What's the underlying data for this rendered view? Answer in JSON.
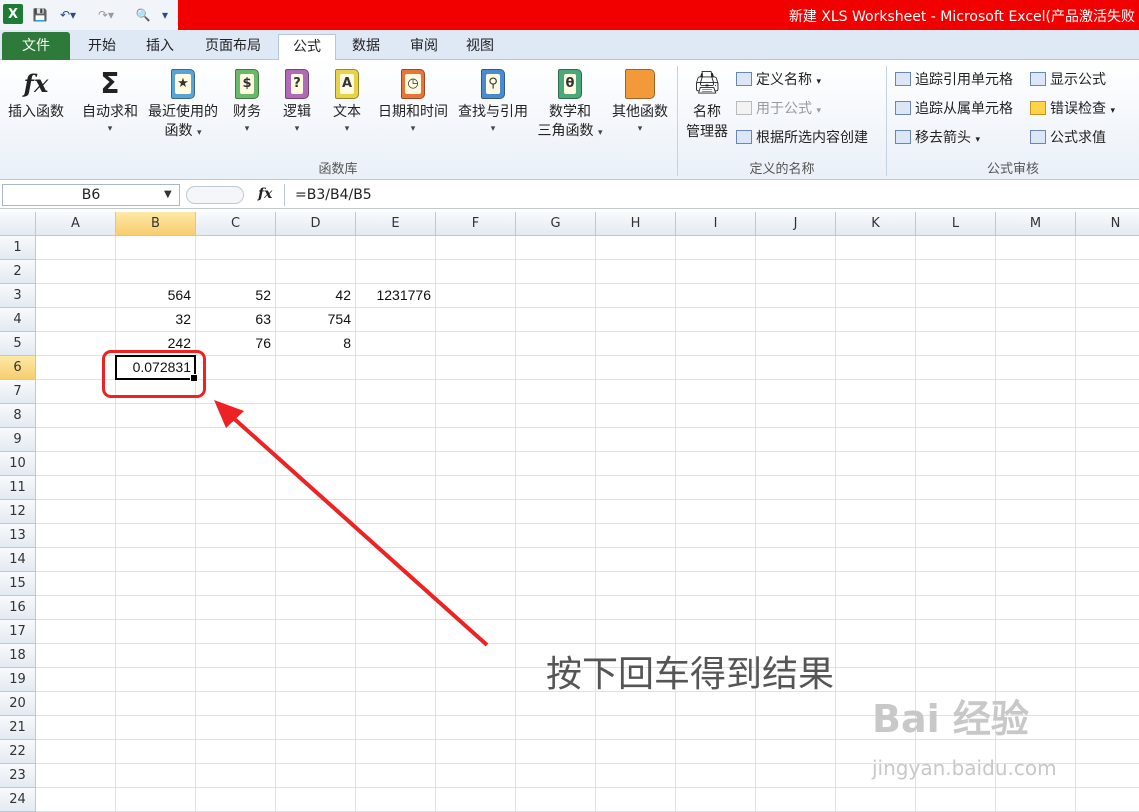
{
  "window": {
    "title": "新建 XLS Worksheet - Microsoft Excel(产品激活失败"
  },
  "tabs": [
    {
      "label": "文件"
    },
    {
      "label": "开始"
    },
    {
      "label": "插入"
    },
    {
      "label": "页面布局"
    },
    {
      "label": "公式"
    },
    {
      "label": "数据"
    },
    {
      "label": "审阅"
    },
    {
      "label": "视图"
    }
  ],
  "ribbon": {
    "function_library": {
      "group_label": "函数库",
      "buttons": [
        {
          "label": "插入函数",
          "icon": "fx-icon"
        },
        {
          "label": "自动求和",
          "icon": "sigma-icon"
        },
        {
          "label": "最近使用的",
          "label2": "函数",
          "icon": "book-star-icon"
        },
        {
          "label": "财务",
          "icon": "book-finance-icon"
        },
        {
          "label": "逻辑",
          "icon": "book-question-icon"
        },
        {
          "label": "文本",
          "icon": "book-text-icon"
        },
        {
          "label": "日期和时间",
          "icon": "book-calendar-icon"
        },
        {
          "label": "查找与引用",
          "icon": "book-search-icon"
        },
        {
          "label": "数学和",
          "label2": "三角函数",
          "icon": "book-theta-icon"
        },
        {
          "label": "其他函数",
          "icon": "books-icon"
        }
      ]
    },
    "defined_names": {
      "group_label": "定义的名称",
      "name_manager": {
        "label": "名称",
        "label2": "管理器"
      },
      "define_name": "定义名称",
      "use_in_formula": "用于公式",
      "create_from_selection": "根据所选内容创建"
    },
    "formula_auditing": {
      "group_label": "公式审核",
      "trace_precedents": "追踪引用单元格",
      "trace_dependents": "追踪从属单元格",
      "remove_arrows": "移去箭头",
      "show_formulas": "显示公式",
      "error_checking": "错误检查",
      "evaluate_formula": "公式求值"
    }
  },
  "formula_bar": {
    "name_box": "B6",
    "fx": "fx",
    "formula": "=B3/B4/B5"
  },
  "sheet": {
    "columns": [
      "A",
      "B",
      "C",
      "D",
      "E",
      "F",
      "G",
      "H",
      "I",
      "J",
      "K",
      "L",
      "M",
      "N"
    ],
    "rows": [
      "1",
      "2",
      "3",
      "4",
      "5",
      "6",
      "7",
      "8",
      "9",
      "10",
      "11",
      "12",
      "13",
      "14",
      "15",
      "16",
      "17",
      "18",
      "19",
      "20",
      "21",
      "22",
      "23",
      "24"
    ],
    "selected_column": "B",
    "selected_row": "6",
    "cells": [
      {
        "ref": "B3",
        "value": "564"
      },
      {
        "ref": "C3",
        "value": "52"
      },
      {
        "ref": "D3",
        "value": "42"
      },
      {
        "ref": "E3",
        "value": "1231776"
      },
      {
        "ref": "B4",
        "value": "32"
      },
      {
        "ref": "C4",
        "value": "63"
      },
      {
        "ref": "D4",
        "value": "754"
      },
      {
        "ref": "B5",
        "value": "242"
      },
      {
        "ref": "C5",
        "value": "76"
      },
      {
        "ref": "D5",
        "value": "8"
      },
      {
        "ref": "B6",
        "value": "0.072831"
      }
    ]
  },
  "annotation": {
    "text": "按下回车得到结果",
    "color": "#ee2222"
  },
  "watermark": {
    "line1": "Bai 经验",
    "line2": "jingyan.baidu.com"
  }
}
